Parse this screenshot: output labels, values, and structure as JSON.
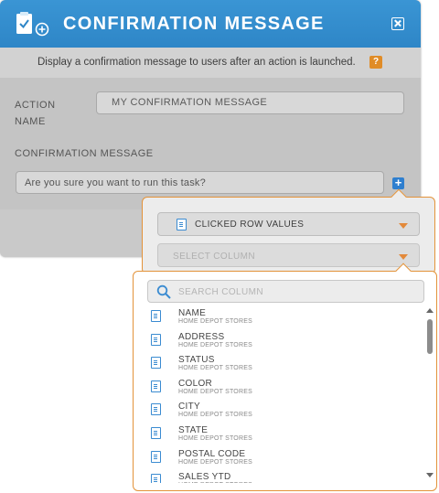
{
  "dialog": {
    "title": "CONFIRMATION MESSAGE",
    "description": "Display a confirmation message to users after an action is launched.",
    "help_label": "?",
    "action_name_label": "ACTION NAME",
    "action_name_value": "MY CONFIRMATION MESSAGE",
    "confirmation_label": "CONFIRMATION MESSAGE",
    "confirmation_value": "Are you sure you want to run this task?",
    "add_label": "+"
  },
  "insert_menu": {
    "source_select": "CLICKED ROW VALUES",
    "column_select_placeholder": "SELECT COLUMN"
  },
  "column_list": {
    "search_placeholder": "SEARCH COLUMN",
    "items": [
      {
        "name": "NAME",
        "source": "HOME DEPOT STORES"
      },
      {
        "name": "ADDRESS",
        "source": "HOME DEPOT STORES"
      },
      {
        "name": "STATUS",
        "source": "HOME DEPOT STORES"
      },
      {
        "name": "COLOR",
        "source": "HOME DEPOT STORES"
      },
      {
        "name": "CITY",
        "source": "HOME DEPOT STORES"
      },
      {
        "name": "STATE",
        "source": "HOME DEPOT STORES"
      },
      {
        "name": "POSTAL CODE",
        "source": "HOME DEPOT STORES"
      },
      {
        "name": "SALES YTD",
        "source": "HOME DEPOT STORES"
      }
    ]
  },
  "colors": {
    "header_blue": "#2e86c7",
    "accent_orange": "#e3933a",
    "icon_blue": "#3a8bd1"
  },
  "icons": [
    "clipboard-check-icon",
    "close-icon",
    "help-icon",
    "plus-icon",
    "column-icon",
    "chevron-down-icon",
    "search-icon"
  ]
}
